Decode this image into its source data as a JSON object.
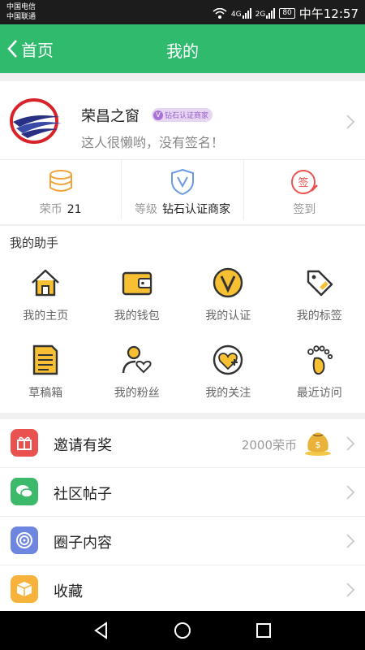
{
  "status_bar": {
    "carrier1": "中国电信",
    "carrier2": "中国联通",
    "net1": "4G",
    "net2": "2G",
    "battery": "80",
    "time": "中午12:57"
  },
  "nav": {
    "back_label": "首页",
    "title": "我的"
  },
  "profile": {
    "name": "荣昌之窗",
    "badge": "钻石认证商家",
    "badge_icon": "V",
    "signature": "这人很懒哟，没有签名！",
    "stats": {
      "coins_label": "荣币",
      "coins_value": "21",
      "level_label": "等级",
      "level_value": "钻石认证商家",
      "checkin_label": "签到",
      "checkin_icon_text": "签"
    }
  },
  "helper": {
    "title": "我的助手",
    "items": [
      {
        "label": "我的主页",
        "icon": "home-icon"
      },
      {
        "label": "我的钱包",
        "icon": "wallet-icon"
      },
      {
        "label": "我的认证",
        "icon": "verify-icon"
      },
      {
        "label": "我的标签",
        "icon": "tag-icon"
      },
      {
        "label": "草稿箱",
        "icon": "draft-icon"
      },
      {
        "label": "我的粉丝",
        "icon": "fans-icon"
      },
      {
        "label": "我的关注",
        "icon": "follow-icon"
      },
      {
        "label": "最近访问",
        "icon": "footprint-icon"
      }
    ]
  },
  "menu": {
    "invite": {
      "label": "邀请有奖",
      "value": "2000荣币",
      "icon": "gift-icon"
    },
    "posts": {
      "label": "社区帖子",
      "icon": "chat-icon"
    },
    "circle": {
      "label": "圈子内容",
      "icon": "circle-icon"
    },
    "favorites": {
      "label": "收藏",
      "icon": "box-icon"
    }
  },
  "colors": {
    "brand_green": "#2fba6e",
    "accent_orange": "#f2a33a",
    "invite_red": "#e9524f",
    "posts_green": "#3cb96a",
    "circle_blue": "#6f86e0",
    "fav_yellow": "#f7b23b",
    "badge_purple": "#a972d6"
  }
}
